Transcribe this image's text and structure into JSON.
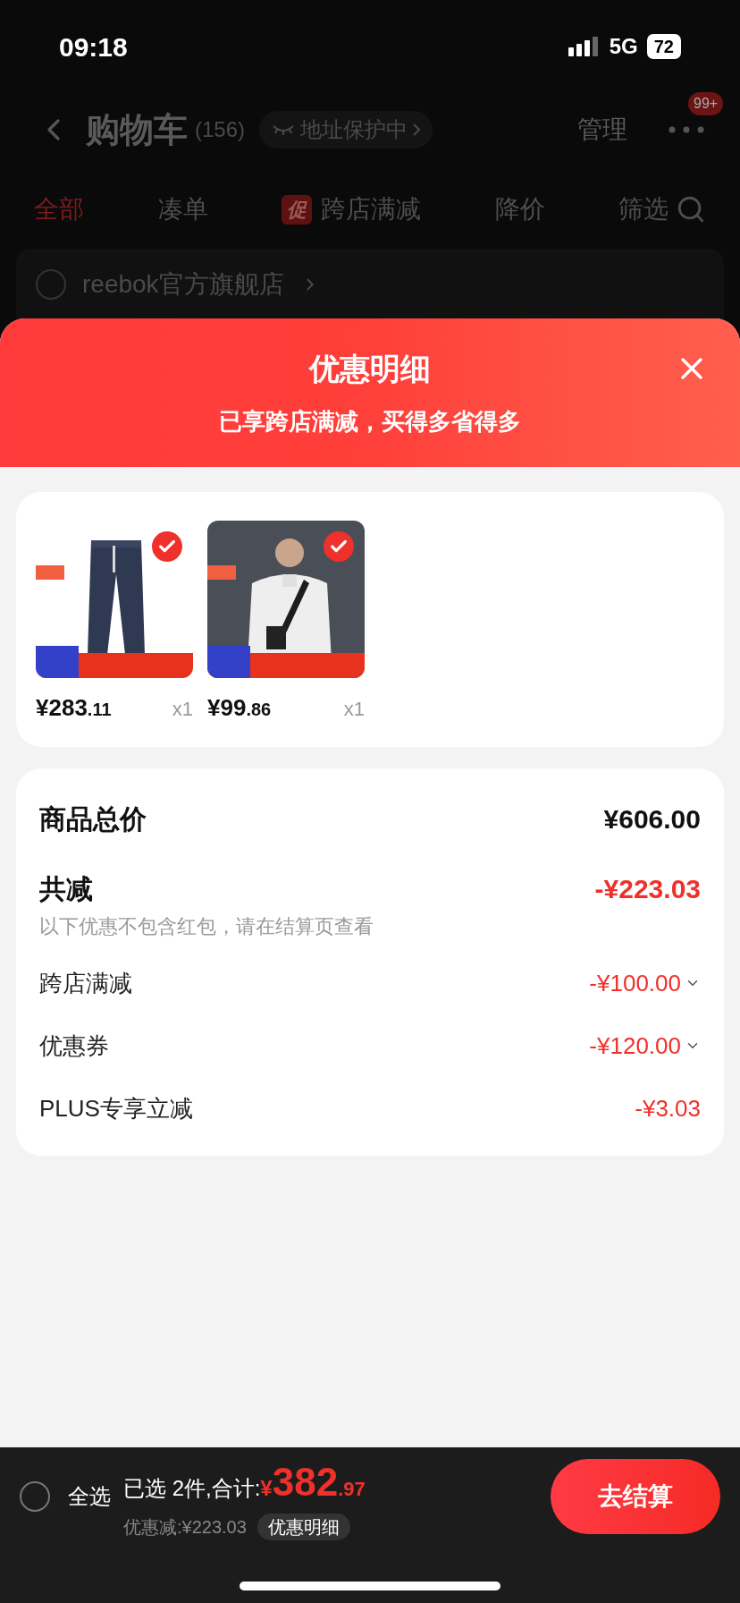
{
  "status_bar": {
    "time": "09:18",
    "network": "5G",
    "battery": "72"
  },
  "cart_header": {
    "title": "购物车",
    "count": "(156)",
    "address_badge": "地址保护中",
    "manage": "管理",
    "message_badge": "99+"
  },
  "filter_tabs": [
    {
      "label": "全部",
      "selected": true
    },
    {
      "label": "凑单",
      "selected": false
    },
    {
      "label": "跨店满减",
      "selected": false,
      "promo_tag": "促"
    },
    {
      "label": "降价",
      "selected": false
    }
  ],
  "filter_button": "筛选",
  "store": {
    "name": "reebok官方旗舰店",
    "checked": false
  },
  "sheet": {
    "title": "优惠明细",
    "subtitle": "已享跨店满减，买得多省得多",
    "items": [
      {
        "kind": "pants",
        "price": "¥283",
        "decimals": ".11",
        "quantity": "x1",
        "selected": true
      },
      {
        "kind": "jacket",
        "price": "¥99",
        "decimals": ".86",
        "quantity": "x1",
        "selected": true
      }
    ],
    "total": {
      "label": "商品总价",
      "value": "¥606.00"
    },
    "reduction": {
      "label": "共减",
      "value": "-¥223.03",
      "note": "以下优惠不包含红包，请在结算页查看"
    },
    "discounts": [
      {
        "label": "跨店满减",
        "value": "-¥100.00",
        "expandable": true
      },
      {
        "label": "优惠券",
        "value": "-¥120.00",
        "expandable": true
      },
      {
        "label": "PLUS专享立减",
        "value": "-¥3.03",
        "expandable": false
      }
    ]
  },
  "bottom_bar": {
    "select_all": {
      "label": "全选",
      "checked": false
    },
    "selected_text": "已选 2件,合计:",
    "currency": "¥",
    "amount": "382",
    "decimals": ".97",
    "discount_text": "优惠减:¥223.03",
    "detail_button": "优惠明细",
    "checkout": "去结算"
  }
}
